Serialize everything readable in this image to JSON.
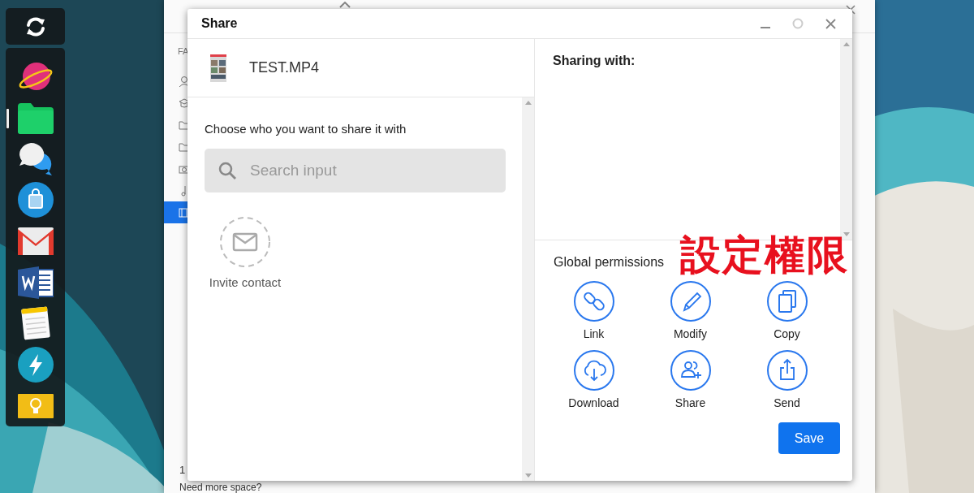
{
  "dock": {
    "top": [
      {
        "kind": "sync"
      }
    ],
    "apps": [
      {
        "kind": "planet",
        "selected": false
      },
      {
        "kind": "folder",
        "selected": true
      },
      {
        "kind": "chat",
        "selected": false
      },
      {
        "kind": "bag",
        "selected": false
      },
      {
        "kind": "mail",
        "selected": false
      },
      {
        "kind": "doc",
        "selected": false
      },
      {
        "kind": "notepad",
        "selected": false
      },
      {
        "kind": "bolt",
        "selected": false
      },
      {
        "kind": "bulb",
        "selected": false
      }
    ]
  },
  "files_window": {
    "sidebar_heading": "FA",
    "sidebar_items": [
      {
        "kind": "person",
        "selected": false
      },
      {
        "kind": "hat",
        "selected": false
      },
      {
        "kind": "folder",
        "selected": false
      },
      {
        "kind": "folder",
        "selected": false
      },
      {
        "kind": "camera",
        "selected": false
      },
      {
        "kind": "music",
        "selected": false
      },
      {
        "kind": "film",
        "selected": true
      }
    ],
    "storage": "1",
    "footer": "Need more space?"
  },
  "dialog": {
    "title": "Share",
    "file": {
      "name": "TEST.MP4"
    },
    "prompt": "Choose who you want to share it with",
    "search": {
      "placeholder": "Search input"
    },
    "invite": "Invite contact",
    "sharing_heading": "Sharing with:",
    "permissions": {
      "heading": "Global permissions",
      "items": [
        {
          "kind": "link",
          "label": "Link"
        },
        {
          "kind": "pencil",
          "label": "Modify"
        },
        {
          "kind": "copy",
          "label": "Copy"
        },
        {
          "kind": "download",
          "label": "Download"
        },
        {
          "kind": "share",
          "label": "Share"
        },
        {
          "kind": "send",
          "label": "Send"
        }
      ]
    },
    "save": "Save"
  },
  "annotation": "設定權限"
}
